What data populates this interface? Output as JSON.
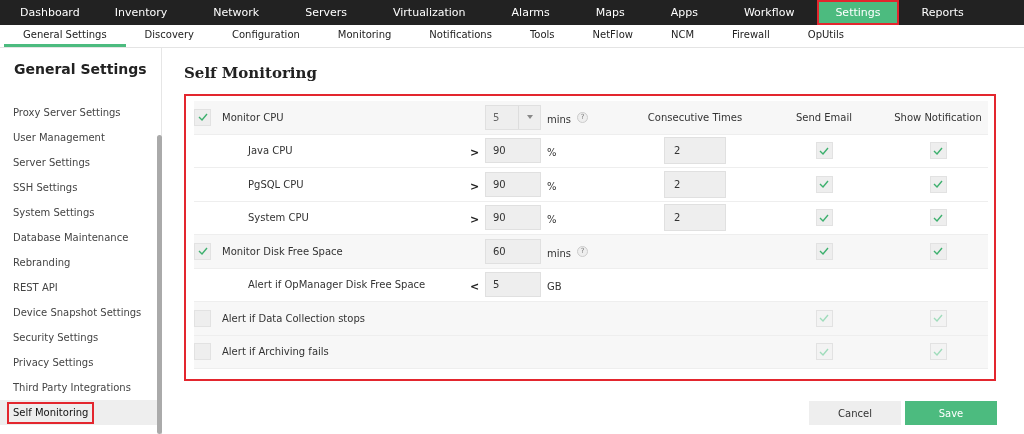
{
  "top_nav": [
    {
      "label": "Dashboard",
      "selected": false,
      "highlighted": false
    },
    {
      "label": "Inventory",
      "selected": false,
      "highlighted": false
    },
    {
      "label": "Network",
      "selected": false,
      "highlighted": false
    },
    {
      "label": "Servers",
      "selected": false,
      "highlighted": false
    },
    {
      "label": "Virtualization",
      "selected": false,
      "highlighted": false
    },
    {
      "label": "Alarms",
      "selected": false,
      "highlighted": false
    },
    {
      "label": "Maps",
      "selected": false,
      "highlighted": false
    },
    {
      "label": "Apps",
      "selected": false,
      "highlighted": false
    },
    {
      "label": "Workflow",
      "selected": false,
      "highlighted": false
    },
    {
      "label": "Settings",
      "selected": true,
      "highlighted": true
    },
    {
      "label": "Reports",
      "selected": false,
      "highlighted": false
    }
  ],
  "sub_nav": [
    {
      "label": "General Settings",
      "selected": true
    },
    {
      "label": "Discovery",
      "selected": false
    },
    {
      "label": "Configuration",
      "selected": false
    },
    {
      "label": "Monitoring",
      "selected": false
    },
    {
      "label": "Notifications",
      "selected": false
    },
    {
      "label": "Tools",
      "selected": false
    },
    {
      "label": "NetFlow",
      "selected": false
    },
    {
      "label": "NCM",
      "selected": false
    },
    {
      "label": "Firewall",
      "selected": false
    },
    {
      "label": "OpUtils",
      "selected": false
    }
  ],
  "sidebar": {
    "title": "General Settings",
    "items": [
      {
        "label": "Proxy Server Settings",
        "selected": false,
        "highlighted": false
      },
      {
        "label": "User Management",
        "selected": false,
        "highlighted": false
      },
      {
        "label": "Server Settings",
        "selected": false,
        "highlighted": false
      },
      {
        "label": "SSH Settings",
        "selected": false,
        "highlighted": false
      },
      {
        "label": "System Settings",
        "selected": false,
        "highlighted": false
      },
      {
        "label": "Database Maintenance",
        "selected": false,
        "highlighted": false
      },
      {
        "label": "Rebranding",
        "selected": false,
        "highlighted": false
      },
      {
        "label": "REST API",
        "selected": false,
        "highlighted": false
      },
      {
        "label": "Device Snapshot Settings",
        "selected": false,
        "highlighted": false
      },
      {
        "label": "Security Settings",
        "selected": false,
        "highlighted": false
      },
      {
        "label": "Privacy Settings",
        "selected": false,
        "highlighted": false
      },
      {
        "label": "Third Party Integrations",
        "selected": false,
        "highlighted": false
      },
      {
        "label": "Self Monitoring",
        "selected": true,
        "highlighted": true
      }
    ]
  },
  "page_title": "Self Monitoring",
  "table": {
    "highlighted": true,
    "columns": [
      "Consecutive Times",
      "Send Email",
      "Show Notification"
    ],
    "rows": [
      {
        "kind": "main",
        "checked": true,
        "label": "Monitor CPU",
        "input": {
          "kind": "dropdown",
          "value": "5"
        },
        "unit": "mins",
        "help": "?"
      },
      {
        "kind": "sub",
        "label": "Java CPU",
        "comparator": ">",
        "input": {
          "kind": "text",
          "value": "90"
        },
        "unit": "%",
        "consecutive": "2",
        "send_email": {
          "checked": true,
          "disabled": false
        },
        "show_notification": {
          "checked": true,
          "disabled": false
        }
      },
      {
        "kind": "sub",
        "label": "PgSQL CPU",
        "comparator": ">",
        "input": {
          "kind": "text",
          "value": "90"
        },
        "unit": "%",
        "consecutive": "2",
        "send_email": {
          "checked": true,
          "disabled": false
        },
        "show_notification": {
          "checked": true,
          "disabled": false
        }
      },
      {
        "kind": "sub",
        "label": "System CPU",
        "comparator": ">",
        "input": {
          "kind": "text",
          "value": "90"
        },
        "unit": "%",
        "consecutive": "2",
        "send_email": {
          "checked": true,
          "disabled": false
        },
        "show_notification": {
          "checked": true,
          "disabled": false
        }
      },
      {
        "kind": "main",
        "checked": true,
        "label": "Monitor Disk Free Space",
        "input": {
          "kind": "text",
          "value": "60"
        },
        "unit": "mins",
        "help": "?",
        "send_email": {
          "checked": true,
          "disabled": false
        },
        "show_notification": {
          "checked": true,
          "disabled": false
        }
      },
      {
        "kind": "sub",
        "label": "Alert if OpManager Disk Free Space",
        "comparator": "<",
        "input": {
          "kind": "text",
          "value": "5"
        },
        "unit": "GB"
      },
      {
        "kind": "main",
        "checked": false,
        "label": "Alert if Data Collection stops",
        "send_email": {
          "checked": true,
          "disabled": true
        },
        "show_notification": {
          "checked": true,
          "disabled": true
        }
      },
      {
        "kind": "main",
        "checked": false,
        "label": "Alert if Archiving fails",
        "send_email": {
          "checked": true,
          "disabled": true
        },
        "show_notification": {
          "checked": true,
          "disabled": true
        }
      }
    ]
  },
  "buttons": [
    {
      "kind": "secondary",
      "label": "Cancel"
    },
    {
      "kind": "primary",
      "label": "Save"
    }
  ]
}
